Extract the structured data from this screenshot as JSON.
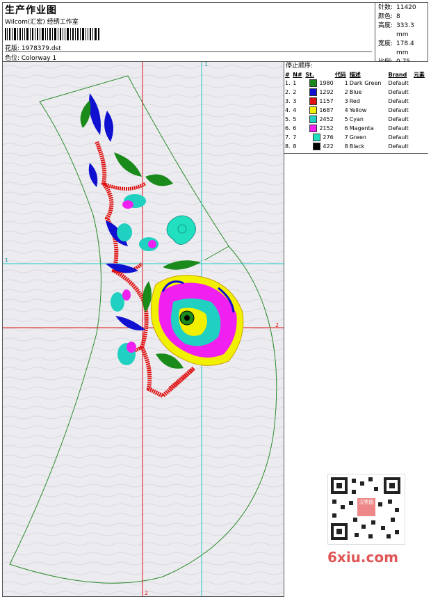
{
  "header": {
    "title": "生产作业图",
    "company": "Wilcom(汇宏) 经绣工作室",
    "file_label": "花版: 1978379.dst",
    "colorway_label": "色位: Colorway 1"
  },
  "stats": [
    {
      "key": "针数:",
      "value": "11420"
    },
    {
      "key": "颜色:",
      "value": "8"
    },
    {
      "key": "高度:",
      "value": "333.3 mm"
    },
    {
      "key": "宽度:",
      "value": "178.4 mm"
    },
    {
      "key": "比例:",
      "value": "0.75"
    }
  ],
  "panel": {
    "title": "停止顺序:",
    "headers": [
      "#",
      "N#",
      "St.",
      "代码",
      "描述",
      "Brand",
      "元素"
    ],
    "rows": [
      {
        "idx": "1.",
        "n": "1",
        "color": "#1a8a1a",
        "st": "1980",
        "code": "1",
        "desc": "Dark Green",
        "brand": "Default"
      },
      {
        "idx": "2.",
        "n": "2",
        "color": "#1010d0",
        "st": "1292",
        "code": "2",
        "desc": "Blue",
        "brand": "Default"
      },
      {
        "idx": "3.",
        "n": "3",
        "color": "#e01010",
        "st": "1157",
        "code": "3",
        "desc": "Red",
        "brand": "Default"
      },
      {
        "idx": "4.",
        "n": "4",
        "color": "#f0f000",
        "st": "1687",
        "code": "4",
        "desc": "Yellow",
        "brand": "Default"
      },
      {
        "idx": "5.",
        "n": "5",
        "color": "#20d0c0",
        "st": "2452",
        "code": "5",
        "desc": "Cyan",
        "brand": "Default"
      },
      {
        "idx": "6.",
        "n": "6",
        "color": "#f020f0",
        "st": "2152",
        "code": "6",
        "desc": "Magenta",
        "brand": "Default"
      },
      {
        "idx": "7.",
        "n": "7",
        "color": "#20e0c0",
        "st": "276",
        "code": "7",
        "desc": "Green",
        "brand": "Default"
      },
      {
        "idx": "8.",
        "n": "8",
        "color": "#000000",
        "st": "422",
        "code": "8",
        "desc": "Black",
        "brand": "Default"
      }
    ]
  },
  "guides": {
    "marker_1": "1",
    "marker_2": "2"
  },
  "watermark": {
    "site": "6xiu.com",
    "badge": "汉秀图"
  },
  "colors": {
    "outline": "#2a8a2a",
    "guide_red": "#e01010",
    "guide_cyan": "#20c8c8"
  }
}
